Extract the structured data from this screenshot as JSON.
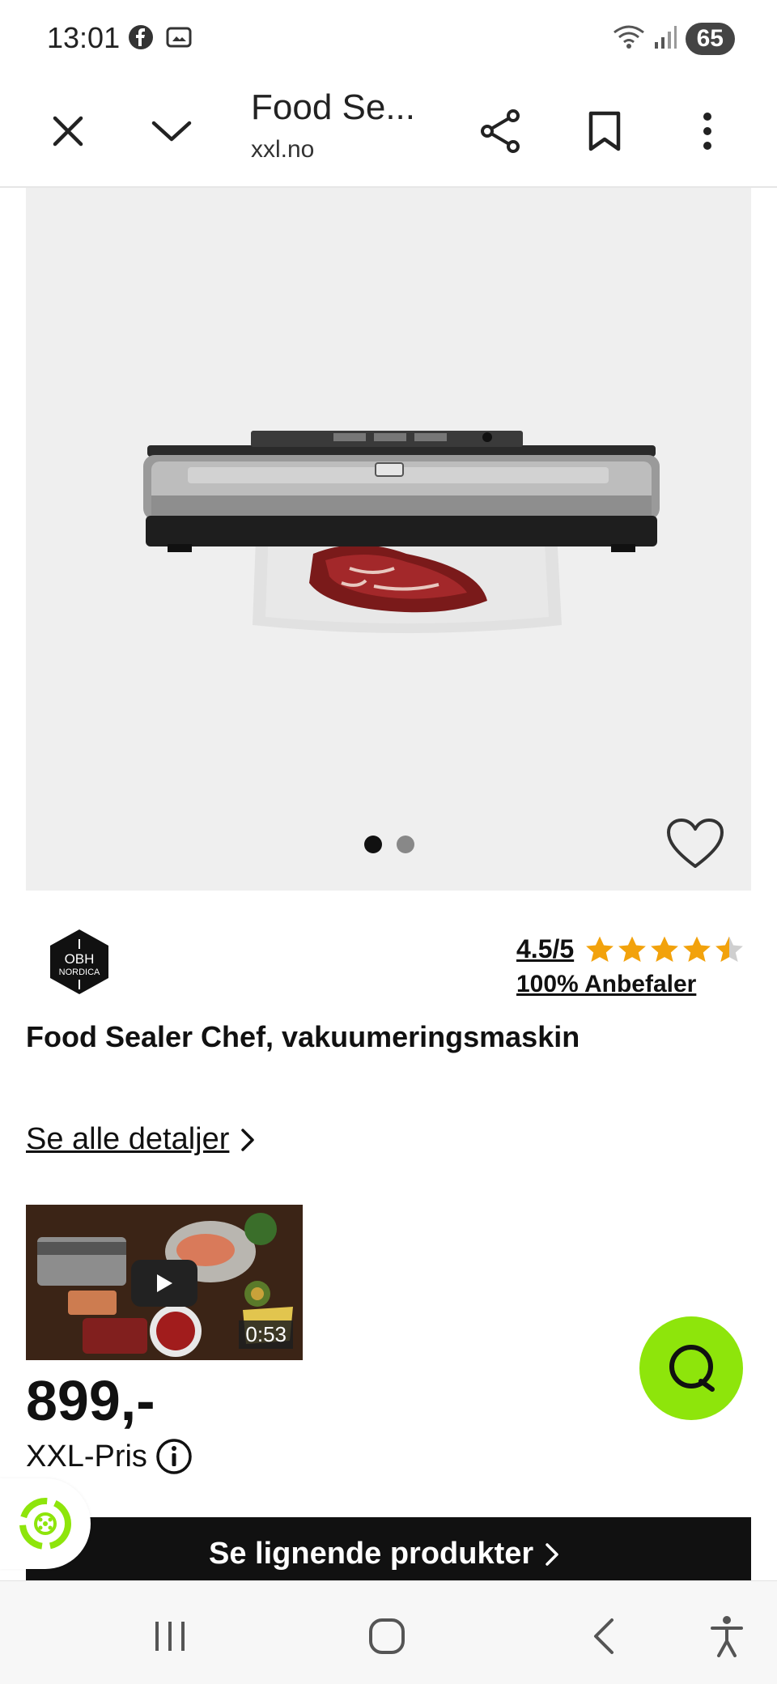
{
  "status": {
    "time": "13:01",
    "battery": "65",
    "icons": [
      "facebook-icon",
      "screenshot-icon",
      "wifi-icon",
      "signal-icon"
    ]
  },
  "browser": {
    "title": "Food Se...",
    "url": "xxl.no",
    "icons": [
      "close-icon",
      "chevron-down-icon",
      "share-icon",
      "bookmark-icon",
      "more-vert-icon"
    ]
  },
  "product": {
    "brand": "OBH NORDICA",
    "rating": "4.5/5",
    "rating_stars": 4.5,
    "recommend": "100% Anbefaler",
    "title": "Food Sealer Chef, vakuumeringsmaskin",
    "details_link": "Se alle detaljer",
    "video_duration": "0:53",
    "price": "899,-",
    "price_label": "XXL-Pris",
    "image_pages": 2,
    "image_current": 1
  },
  "cta": {
    "label": "Se lignende produkter"
  },
  "colors": {
    "star": "#f2a20c",
    "chat": "#8ee50b",
    "eco": "#8ee50b",
    "cta_bg": "#111111"
  }
}
